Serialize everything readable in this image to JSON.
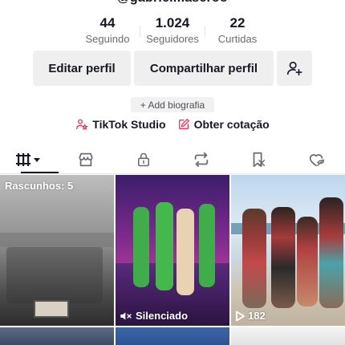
{
  "profile": {
    "handle_partial": "@gabrielmaseroo"
  },
  "stats": [
    {
      "value": "44",
      "label": "Seguindo"
    },
    {
      "value": "1.024",
      "label": "Seguidores"
    },
    {
      "value": "22",
      "label": "Curtidas"
    }
  ],
  "actions": {
    "edit_label": "Editar perfil",
    "share_label": "Compartilhar perfil",
    "add_friend_icon": "person-plus-icon"
  },
  "bio": {
    "add_label": "+ Add biografia"
  },
  "links": {
    "studio_label": "TikTok Studio",
    "quote_label": "Obter cotação"
  },
  "tabs": [
    {
      "name": "videos-grid",
      "icon": "grid-bars-icon",
      "active": true
    },
    {
      "name": "shop",
      "icon": "shop-icon"
    },
    {
      "name": "private",
      "icon": "lock-icon"
    },
    {
      "name": "reposts",
      "icon": "repost-icon"
    },
    {
      "name": "favorites",
      "icon": "bookmark-icon"
    },
    {
      "name": "liked",
      "icon": "heart-hidden-icon"
    }
  ],
  "videos": [
    {
      "overlay": "Rascunhos: 5"
    },
    {
      "overlay": "Silenciado",
      "overlay_icon": "muted-speaker-icon"
    },
    {
      "overlay": "182",
      "overlay_icon": "play-icon"
    }
  ],
  "colors": {
    "accent": "#fe2c55",
    "text": "#161823",
    "muted": "#6b6b73",
    "button_bg": "#efeff0"
  }
}
